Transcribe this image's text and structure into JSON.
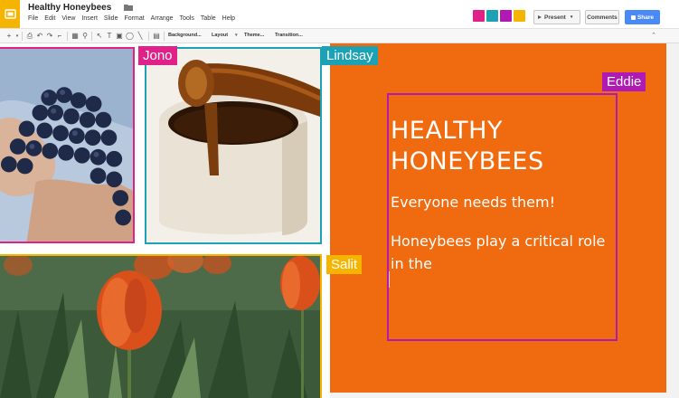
{
  "header": {
    "doc_title": "Healthy Honeybees",
    "menu": [
      "File",
      "Edit",
      "View",
      "Insert",
      "Slide",
      "Format",
      "Arrange",
      "Tools",
      "Table",
      "Help"
    ],
    "present_label": "Present",
    "comments_label": "Comments",
    "share_label": "Share"
  },
  "toolbar": {
    "background_label": "Background...",
    "layout_label": "Layout",
    "theme_label": "Theme...",
    "transition_label": "Transition..."
  },
  "collaborators": [
    {
      "name": "Jono",
      "color": "#e0218a"
    },
    {
      "name": "Lindsay",
      "color": "#1da1b5"
    },
    {
      "name": "Eddie",
      "color": "#b01ab4"
    },
    {
      "name": "Salit",
      "color": "#f4b400"
    }
  ],
  "slide": {
    "title": "HEALTHY HONEYBEES",
    "subtitle": "Everyone needs them!",
    "body": "Honeybees play a critical role in the",
    "background_color": "#f06a0f"
  },
  "colors": {
    "app_accent": "#f4b400",
    "share_button": "#4a8af4"
  }
}
